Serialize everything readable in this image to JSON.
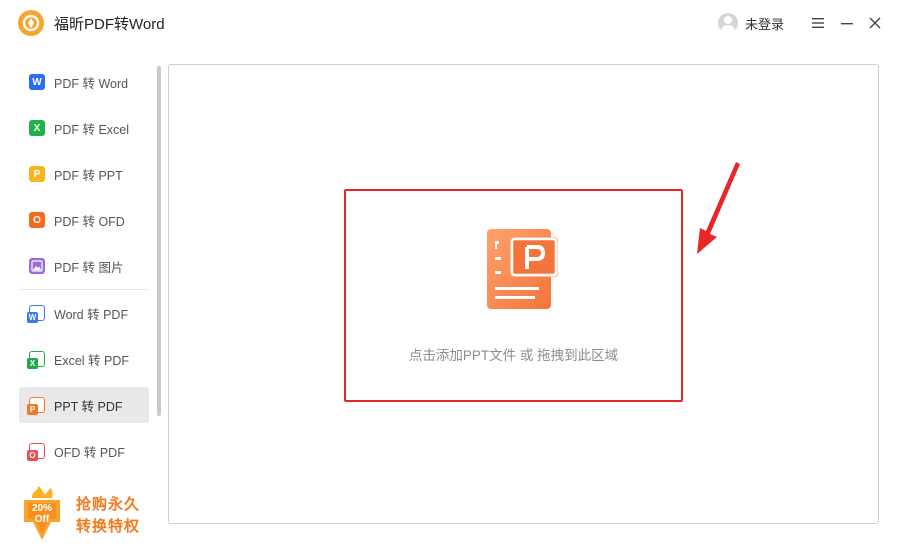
{
  "app": {
    "title": "福昕PDF转Word",
    "user_label": "未登录"
  },
  "window_controls": {
    "menu_icon": "hamburger-menu-icon",
    "minimize_icon": "minimize-icon",
    "close_icon": "close-icon"
  },
  "sidebar": {
    "items": [
      {
        "label": "PDF 转 Word",
        "icon_letter": "W",
        "icon": "word-icon",
        "color": "#2a6ef0"
      },
      {
        "label": "PDF 转 Excel",
        "icon_letter": "X",
        "icon": "excel-icon",
        "color": "#1fb24a"
      },
      {
        "label": "PDF 转 PPT",
        "icon_letter": "P",
        "icon": "ppt-icon",
        "color": "#f7b523"
      },
      {
        "label": "PDF 转 OFD",
        "icon_letter": "O",
        "icon": "ofd-icon",
        "color": "#f26b1e"
      },
      {
        "label": "PDF 转 图片",
        "icon_letter": "",
        "icon": "image-icon",
        "color": "#9b6be0"
      },
      {
        "label": "Word 转 PDF",
        "icon_letter": "W",
        "icon": "word-doc-icon",
        "color": "#3a7ae8"
      },
      {
        "label": "Excel 转 PDF",
        "icon_letter": "X",
        "icon": "excel-doc-icon",
        "color": "#22a84a"
      },
      {
        "label": "PPT 转 PDF",
        "icon_letter": "P",
        "icon": "ppt-doc-icon",
        "color": "#f07a2a"
      },
      {
        "label": "OFD 转 PDF",
        "icon_letter": "O",
        "icon": "ofd-doc-icon",
        "color": "#f04e4e"
      }
    ],
    "active_index": 7
  },
  "promo": {
    "badge_percent": "20%",
    "badge_off": "Off",
    "line1": "抢购永久",
    "line2": "转换特权"
  },
  "drop_zone": {
    "hint": "点击添加PPT文件 或 拖拽到此区域",
    "icon": "ppt-file-icon"
  },
  "colors": {
    "accent_orange": "#f47a1f",
    "highlight_red": "#e8262a"
  }
}
